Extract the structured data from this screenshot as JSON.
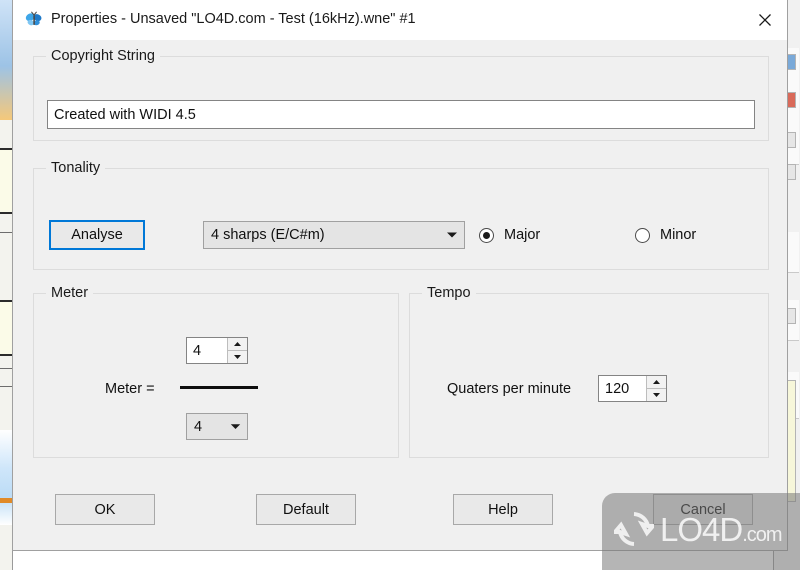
{
  "window": {
    "title": "Properties - Unsaved \"LO4D.com - Test (16kHz).wne\" #1",
    "icon": "butterfly-icon",
    "close_label": "✕"
  },
  "copyright_group": {
    "title": "Copyright String",
    "value": "Created with WIDI 4.5",
    "placeholder": ""
  },
  "tonality_group": {
    "title": "Tonality",
    "analyse_button": "Analyse",
    "key_selected": "4 sharps (E/C#m)",
    "key_options": [
      "4 sharps (E/C#m)"
    ],
    "mode_major": "Major",
    "mode_minor": "Minor",
    "mode_selected": "Major"
  },
  "meter_group": {
    "title": "Meter",
    "label": "Meter  =",
    "numerator": "4",
    "denominator": "4",
    "denominator_options": [
      "4"
    ]
  },
  "tempo_group": {
    "title": "Tempo",
    "label": "Quaters per minute",
    "value": "120"
  },
  "buttons": {
    "ok": "OK",
    "default": "Default",
    "help": "Help",
    "cancel": "Cancel"
  },
  "watermark": {
    "text": "LO4D",
    "suffix": ".com",
    "logo": "refresh-circle-icon"
  },
  "colors": {
    "dialog_background": "#f0f0f0",
    "titlebar_background": "#ffffff",
    "focus_border": "#0078d7",
    "field_background": "#ffffff",
    "combo_background": "#e4e4e4",
    "button_background": "#e9e9e9",
    "group_border": "#dcdcdc",
    "text": "#101010"
  }
}
